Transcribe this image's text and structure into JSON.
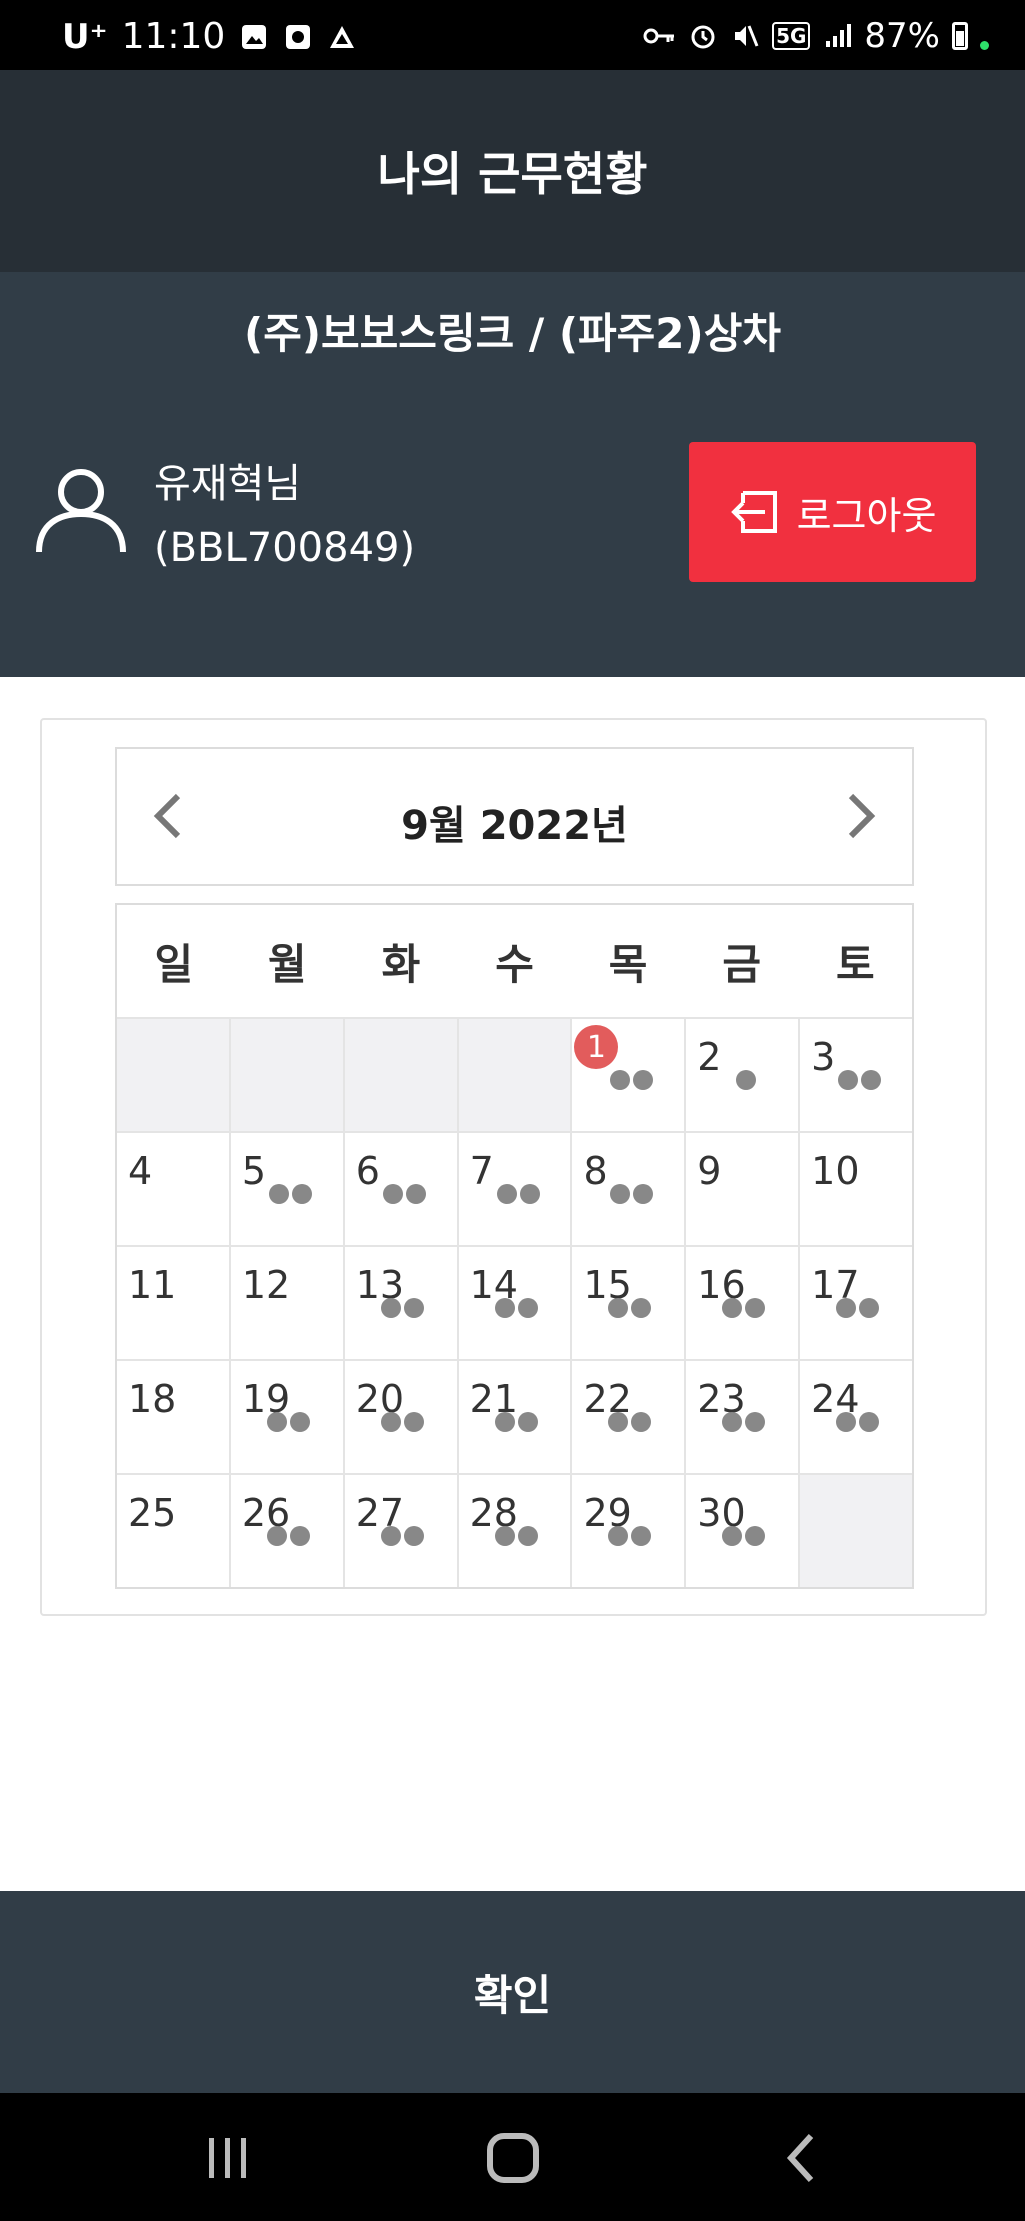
{
  "status_bar": {
    "carrier": "U⁺",
    "time": "11:10",
    "network": "5G",
    "battery": "87%"
  },
  "header": {
    "title": "나의 근무현황"
  },
  "info": {
    "company": "(주)보보스링크 / (파주2)상차",
    "user_name": "유재혁님",
    "user_id": "(BBL700849)",
    "logout_label": "로그아웃"
  },
  "calendar": {
    "month_label": "9월 2022년",
    "weekdays": [
      "일",
      "월",
      "화",
      "수",
      "목",
      "금",
      "토"
    ],
    "weeks": [
      [
        {
          "day": null
        },
        {
          "day": null
        },
        {
          "day": null
        },
        {
          "day": null
        },
        {
          "day": 1,
          "dots": 2,
          "badge": "1"
        },
        {
          "day": 2,
          "dots": 1
        },
        {
          "day": 3,
          "dots": 2
        }
      ],
      [
        {
          "day": 4,
          "dots": 0
        },
        {
          "day": 5,
          "dots": 2
        },
        {
          "day": 6,
          "dots": 2
        },
        {
          "day": 7,
          "dots": 2
        },
        {
          "day": 8,
          "dots": 2
        },
        {
          "day": 9,
          "dots": 0
        },
        {
          "day": 10,
          "dots": 0
        }
      ],
      [
        {
          "day": 11,
          "dots": 0
        },
        {
          "day": 12,
          "dots": 0
        },
        {
          "day": 13,
          "dots": 2
        },
        {
          "day": 14,
          "dots": 2
        },
        {
          "day": 15,
          "dots": 2
        },
        {
          "day": 16,
          "dots": 2
        },
        {
          "day": 17,
          "dots": 2
        }
      ],
      [
        {
          "day": 18,
          "dots": 0
        },
        {
          "day": 19,
          "dots": 2
        },
        {
          "day": 20,
          "dots": 2
        },
        {
          "day": 21,
          "dots": 2
        },
        {
          "day": 22,
          "dots": 2
        },
        {
          "day": 23,
          "dots": 2
        },
        {
          "day": 24,
          "dots": 2
        }
      ],
      [
        {
          "day": 25,
          "dots": 0
        },
        {
          "day": 26,
          "dots": 2
        },
        {
          "day": 27,
          "dots": 2
        },
        {
          "day": 28,
          "dots": 2
        },
        {
          "day": 29,
          "dots": 2
        },
        {
          "day": 30,
          "dots": 2
        },
        {
          "day": null
        }
      ]
    ]
  },
  "footer": {
    "confirm_label": "확인"
  },
  "colors": {
    "title_bg": "#272f36",
    "info_bg": "#313d47",
    "logout_bg": "#f1303f",
    "badge_bg": "#e25c5c",
    "dot": "#888888"
  },
  "nav_icons": [
    "recents-icon",
    "home-icon",
    "back-icon"
  ]
}
